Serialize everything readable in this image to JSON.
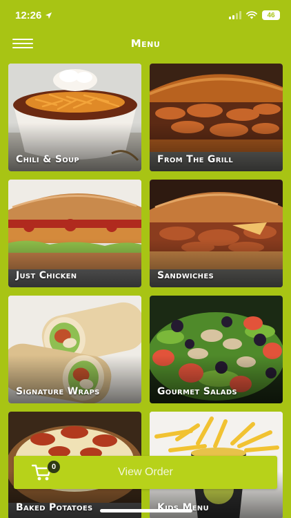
{
  "status_bar": {
    "time": "12:26",
    "battery": "46",
    "location_icon": "location-arrow-icon",
    "signal_icon": "signal-bars-icon",
    "wifi_icon": "wifi-icon"
  },
  "header": {
    "title": "Menu",
    "menu_icon": "hamburger-icon"
  },
  "categories": [
    {
      "label": "Chili & Soup",
      "image": "chili-soup-bowl"
    },
    {
      "label": "From The Grill",
      "image": "grilled-burger"
    },
    {
      "label": "Just Chicken",
      "image": "chicken-sandwich"
    },
    {
      "label": "Sandwiches",
      "image": "pulled-pork-sandwich"
    },
    {
      "label": "Signature Wraps",
      "image": "wraps"
    },
    {
      "label": "Gourmet Salads",
      "image": "berry-salad"
    },
    {
      "label": "Baked Potatoes",
      "image": "loaded-baked-potato"
    },
    {
      "label": "Kids Menu",
      "image": "kids-fries-cup"
    }
  ],
  "order_bar": {
    "label": "View Order",
    "cart_count": "0",
    "cart_icon": "shopping-cart-icon"
  },
  "colors": {
    "brand_green": "#a8c414",
    "button_green": "#b7d21a",
    "text_white": "#ffffff"
  }
}
